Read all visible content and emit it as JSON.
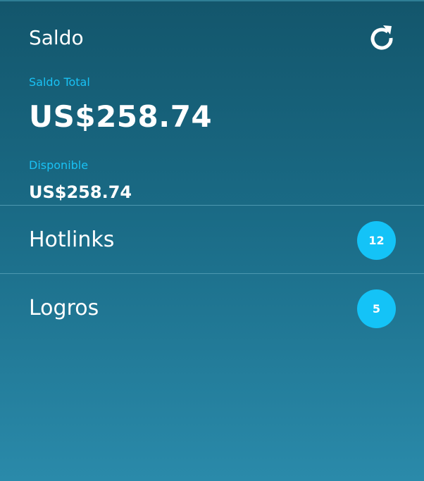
{
  "header": {
    "title": "Saldo",
    "refresh_icon": "refresh-icon"
  },
  "balance": {
    "total_label": "Saldo Total",
    "total_value": "US$258.74",
    "available_label": "Disponible",
    "available_value": "US$258.74"
  },
  "menu": {
    "items": [
      {
        "label": "Hotlinks",
        "count": "12"
      },
      {
        "label": "Logros",
        "count": "5"
      }
    ]
  },
  "colors": {
    "accent": "#14c3f7",
    "label_blue": "#19c2f5",
    "background_top": "#13566c",
    "background_bottom": "#2a8aaa",
    "divider": "#4d98b0"
  }
}
